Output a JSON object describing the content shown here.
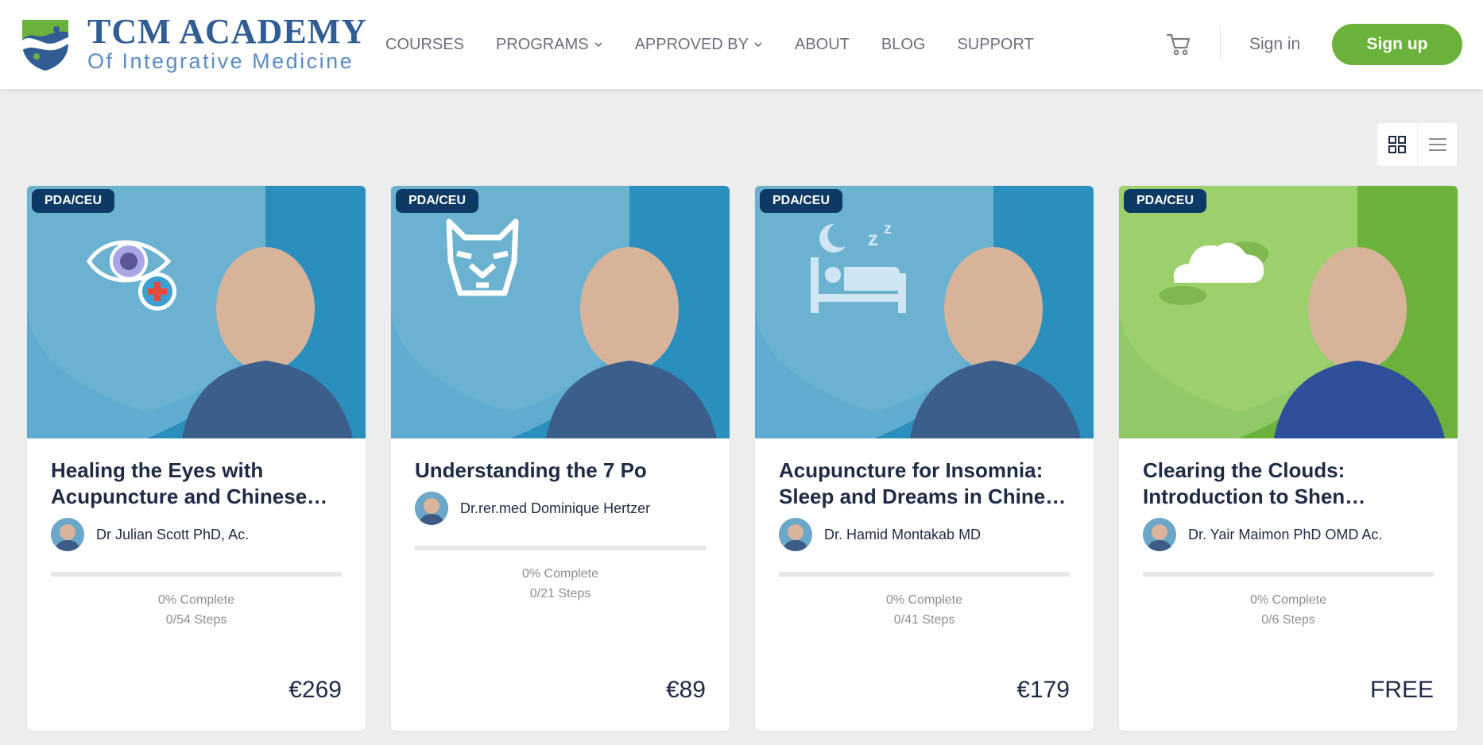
{
  "brand": {
    "title": "TCM ACADEMY",
    "subtitle": "Of Integrative Medicine"
  },
  "nav": {
    "items": [
      {
        "label": "COURSES",
        "dropdown": false
      },
      {
        "label": "PROGRAMS",
        "dropdown": true
      },
      {
        "label": "APPROVED BY",
        "dropdown": true
      },
      {
        "label": "ABOUT",
        "dropdown": false
      },
      {
        "label": "BLOG",
        "dropdown": false
      },
      {
        "label": "SUPPORT",
        "dropdown": false
      }
    ]
  },
  "header": {
    "cart_icon": "cart-icon",
    "signin_label": "Sign in",
    "signup_label": "Sign up"
  },
  "view_toggle": {
    "grid_icon": "grid-icon",
    "list_icon": "list-icon",
    "active": "grid"
  },
  "colors": {
    "accent_green": "#6bb23a",
    "navy": "#0d3a64",
    "blue_card": "#2b8fbe",
    "green_card": "#6bb23a"
  },
  "courses": [
    {
      "badge": "PDA/CEU",
      "icon": "eye-health-icon",
      "title": "Healing the Eyes with Acupuncture and Chinese Herbal Medicine",
      "author": "Dr Julian Scott PhD, Ac.",
      "progress": 0,
      "complete_text": "0% Complete",
      "steps_text": "0/54 Steps",
      "price": "€269",
      "theme": "blue"
    },
    {
      "badge": "PDA/CEU",
      "icon": "tiger-icon",
      "title": "Understanding the 7 Po",
      "author": "Dr.rer.med Dominique Hertzer",
      "progress": 0,
      "complete_text": "0% Complete",
      "steps_text": "0/21 Steps",
      "price": "€89",
      "theme": "blue"
    },
    {
      "badge": "PDA/CEU",
      "icon": "sleep-bed-icon",
      "title": "Acupuncture for Insomnia: Sleep and Dreams in Chinese Medicine",
      "author": "Dr. Hamid Montakab MD",
      "progress": 0,
      "complete_text": "0% Complete",
      "steps_text": "0/41 Steps",
      "price": "€179",
      "theme": "blue"
    },
    {
      "badge": "PDA/CEU",
      "icon": "clouds-icon",
      "title": "Clearing the Clouds: Introduction to Shen Disturbances",
      "author": "Dr. Yair Maimon PhD OMD Ac.",
      "progress": 0,
      "complete_text": "0% Complete",
      "steps_text": "0/6 Steps",
      "price": "FREE",
      "theme": "green"
    }
  ]
}
